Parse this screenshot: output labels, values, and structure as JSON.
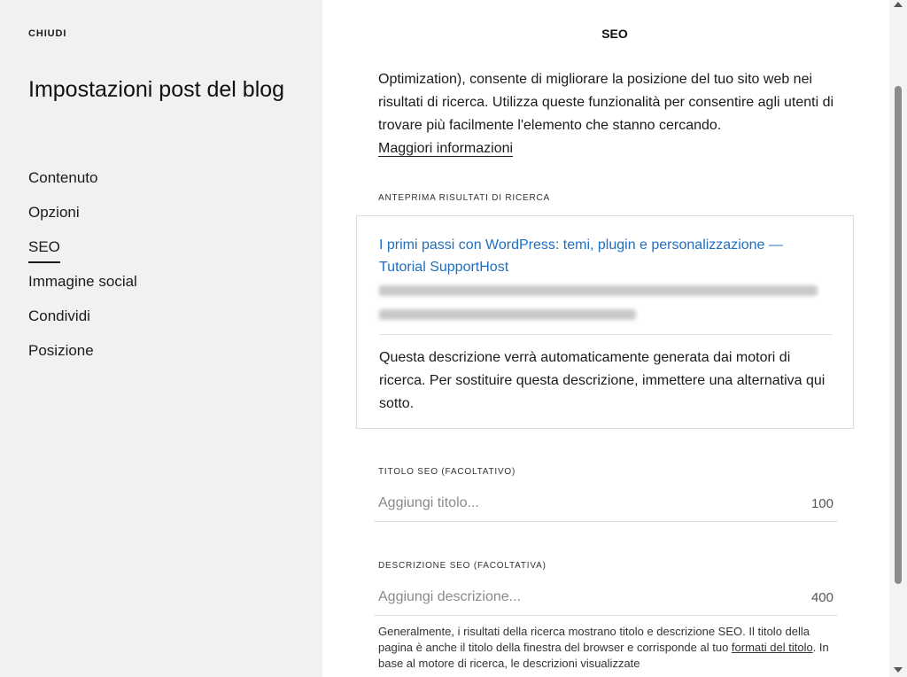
{
  "sidebar": {
    "close_label": "CHIUDI",
    "title": "Impostazioni post del blog",
    "items": [
      {
        "label": "Contenuto"
      },
      {
        "label": "Opzioni"
      },
      {
        "label": "SEO"
      },
      {
        "label": "Immagine social"
      },
      {
        "label": "Condividi"
      },
      {
        "label": "Posizione"
      }
    ],
    "active_item": "SEO"
  },
  "panel": {
    "title": "SEO",
    "intro_text": "Optimization), consente di migliorare la posizione del tuo sito web nei risultati di ricerca. Utilizza queste funzionalità per consentire agli utenti di trovare più facilmente l'elemento che stanno cercando.",
    "more_link": "Maggiori informazioni",
    "preview": {
      "label": "ANTEPRIMA RISULTATI DI RICERCA",
      "title": "I primi passi con WordPress: temi, plugin e personalizzazione — Tutorial SupportHost",
      "description": "Questa descrizione verrà automaticamente generata dai motori di ricerca. Per sostituire questa descrizione, immettere una alternativa qui sotto.",
      "link_color": "#1f6fc0"
    },
    "seo_title": {
      "label": "TITOLO SEO (FACOLTATIVO)",
      "placeholder": "Aggiungi titolo...",
      "value": "",
      "counter": "100"
    },
    "seo_description": {
      "label": "DESCRIZIONE SEO (FACOLTATIVA)",
      "placeholder": "Aggiungi descrizione...",
      "value": "",
      "counter": "400"
    },
    "help": {
      "text_before": "Generalmente, i risultati della ricerca mostrano titolo e descrizione SEO. Il titolo della pagina è anche il titolo della finestra del browser e corrisponde al tuo",
      "link": "formati del titolo",
      "text_after": ". In base al motore di ricerca, le descrizioni visualizzate"
    }
  }
}
